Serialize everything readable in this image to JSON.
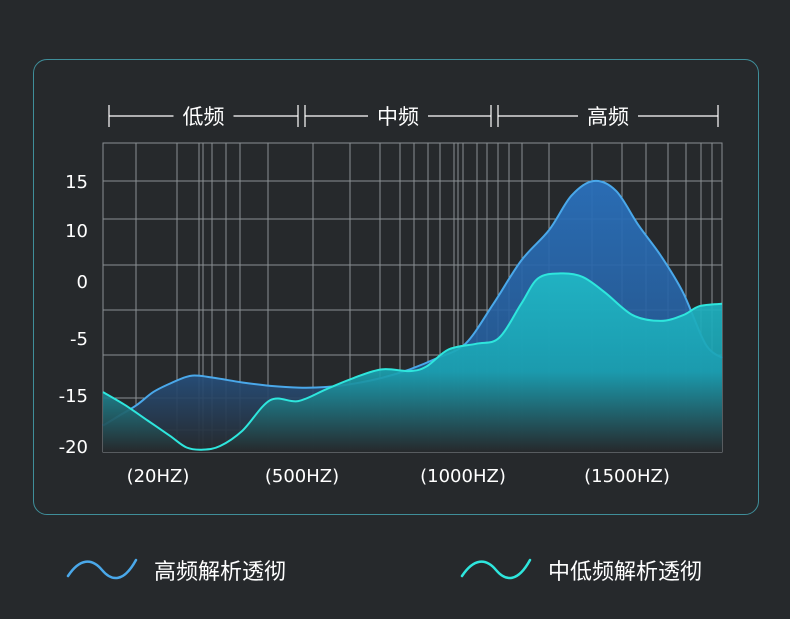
{
  "chart_data": {
    "type": "area",
    "bands": [
      "低频",
      "中频",
      "高频"
    ],
    "y_ticks": [
      "15",
      "10",
      "0",
      "-5",
      "-15",
      "-20"
    ],
    "x_tick_labels": [
      "(20HZ)",
      "(500HZ)",
      "(1000HZ)",
      "(1500HZ)"
    ],
    "grid": true,
    "series": [
      {
        "name": "高频解析透彻",
        "color": "#4aa8ea",
        "fill": "#2a6fb5",
        "points": [
          [
            0,
            -18
          ],
          [
            3,
            -17
          ],
          [
            6,
            -16
          ],
          [
            9,
            -14.5
          ],
          [
            12,
            -13
          ],
          [
            15,
            -11.8
          ],
          [
            17,
            -11.6
          ],
          [
            20,
            -12
          ],
          [
            25,
            -12.8
          ],
          [
            30,
            -13.4
          ],
          [
            35,
            -13.7
          ],
          [
            40,
            -13.6
          ],
          [
            45,
            -13
          ],
          [
            50,
            -12
          ],
          [
            55,
            -10.5
          ],
          [
            60,
            -8.5
          ],
          [
            65,
            -6
          ],
          [
            70,
            -2
          ],
          [
            75,
            4
          ],
          [
            80,
            10
          ],
          [
            84,
            13.5
          ],
          [
            88,
            15
          ],
          [
            92,
            14
          ],
          [
            96,
            10.5
          ],
          [
            100,
            5
          ],
          [
            104,
            -1
          ],
          [
            108,
            -6
          ],
          [
            111,
            -8.5
          ]
        ]
      },
      {
        "name": "中低频解析透彻",
        "color": "#2ee6dd",
        "fill": "#22b8c2",
        "points": [
          [
            0,
            -14.5
          ],
          [
            4,
            -16
          ],
          [
            8,
            -17.5
          ],
          [
            12,
            -19
          ],
          [
            15,
            -20.5
          ],
          [
            18,
            -21.2
          ],
          [
            21,
            -20
          ],
          [
            25,
            -18.5
          ],
          [
            30,
            -15.5
          ],
          [
            35,
            -15.6
          ],
          [
            40,
            -14
          ],
          [
            45,
            -12
          ],
          [
            50,
            -10.5
          ],
          [
            55,
            -10.8
          ],
          [
            58,
            -10
          ],
          [
            62,
            -7
          ],
          [
            67,
            -6
          ],
          [
            71,
            -5
          ],
          [
            75,
            -2
          ],
          [
            78,
            0.5
          ],
          [
            82,
            1.5
          ],
          [
            86,
            0.8
          ],
          [
            90,
            -1
          ],
          [
            95,
            -3
          ],
          [
            100,
            -3.5
          ],
          [
            104,
            -3
          ],
          [
            107,
            -2.2
          ],
          [
            111,
            -2
          ]
        ]
      }
    ]
  }
}
